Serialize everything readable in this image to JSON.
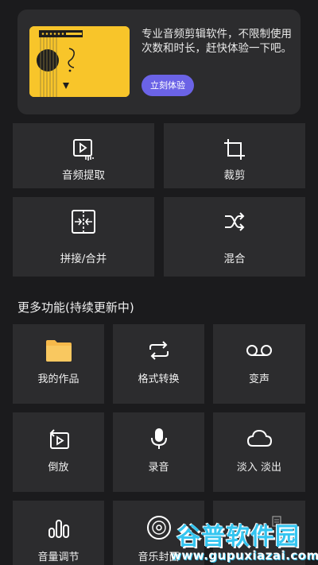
{
  "banner": {
    "text": "专业音频剪辑软件，不限制使用次数和时长，赶快体验一下吧。",
    "button_label": "立刻体验"
  },
  "main_tools": [
    {
      "label": "音频提取",
      "icon": "video-audio-extract-icon"
    },
    {
      "label": "裁剪",
      "icon": "crop-icon"
    },
    {
      "label": "拼接/合并",
      "icon": "merge-icon"
    },
    {
      "label": "混合",
      "icon": "shuffle-mix-icon"
    }
  ],
  "more": {
    "title": "更多功能(持续更新中)",
    "items": [
      {
        "label": "我的作品",
        "icon": "folder-icon"
      },
      {
        "label": "格式转换",
        "icon": "repeat-icon"
      },
      {
        "label": "变声",
        "icon": "voicemail-icon"
      },
      {
        "label": "倒放",
        "icon": "reverse-play-icon"
      },
      {
        "label": "录音",
        "icon": "microphone-icon"
      },
      {
        "label": "淡入 淡出",
        "icon": "cloud-icon"
      },
      {
        "label": "音量调节",
        "icon": "volume-bars-icon"
      },
      {
        "label": "音乐封面",
        "icon": "disc-icon"
      },
      {
        "label": "",
        "icon": "note-icon"
      }
    ]
  },
  "watermark": {
    "main": "谷普软件园",
    "url": "www.gupuxiazai.com"
  },
  "colors": {
    "background": "#1b1b1d",
    "tile": "#2c2c2e",
    "accent_button": "#6b63e6",
    "banner_art": "#f8c52a",
    "folder": "#f6b94b"
  }
}
